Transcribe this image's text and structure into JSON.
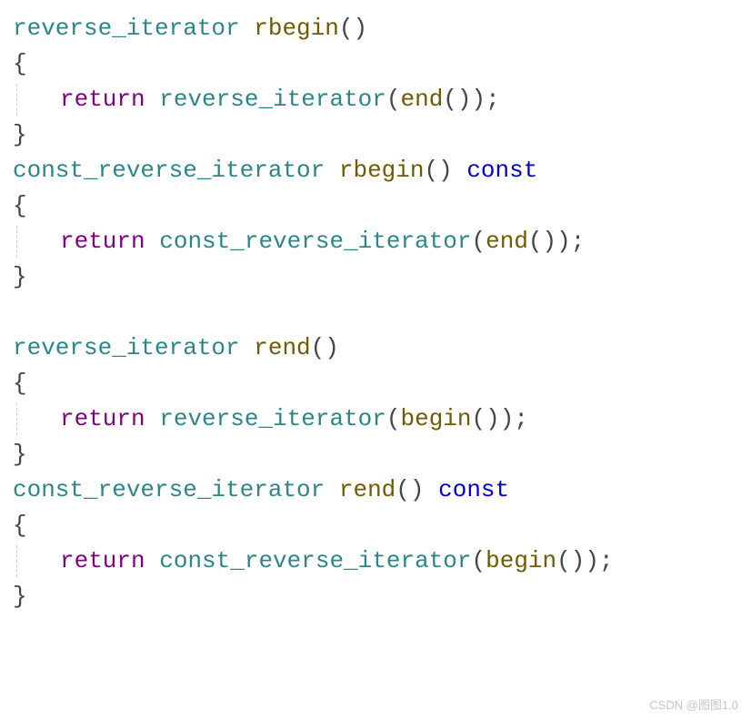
{
  "fn1": {
    "ret_type": "reverse_iterator",
    "name": "rbegin",
    "call_type": "reverse_iterator",
    "call_arg": "end",
    "const_qual": ""
  },
  "fn2": {
    "ret_type": "const_reverse_iterator",
    "name": "rbegin",
    "call_type": "const_reverse_iterator",
    "call_arg": "end",
    "const_qual": "const"
  },
  "fn3": {
    "ret_type": "reverse_iterator",
    "name": "rend",
    "call_type": "reverse_iterator",
    "call_arg": "begin",
    "const_qual": ""
  },
  "fn4": {
    "ret_type": "const_reverse_iterator",
    "name": "rend",
    "call_type": "const_reverse_iterator",
    "call_arg": "begin",
    "const_qual": "const"
  },
  "kw_return": "return",
  "paren_open": "(",
  "paren_close": ")",
  "empty_parens": "()",
  "brace_open": "{",
  "brace_close": "}",
  "semi": ";",
  "sp": " ",
  "watermark": "CSDN @图图1.0"
}
